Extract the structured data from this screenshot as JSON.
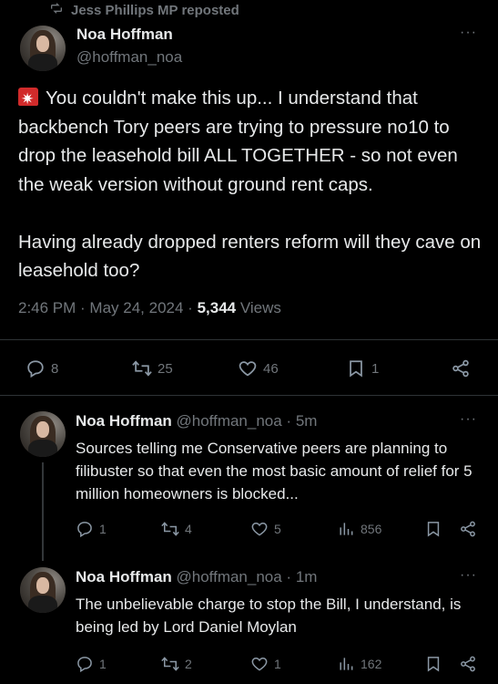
{
  "repost_banner": {
    "label": "Jess Phillips MP reposted",
    "icon": "repost-icon"
  },
  "main_post": {
    "author_name": "Noa Hoffman",
    "author_handle": "@hoffman_noa",
    "more_label": "···",
    "text_line1": "You couldn't make this up... I understand that backbench Tory peers are trying to pressure no10 to drop the leasehold bill ALL TOGETHER - so not even the weak version without ground rent caps.",
    "text_line2": "Having already dropped renters reform will they cave on leasehold too?",
    "emoji": "siren",
    "timestamp": "2:46 PM · May 24, 2024 ·",
    "views_count": "5,344",
    "views_label": "Views",
    "replies": "8",
    "reposts": "25",
    "likes": "46",
    "bookmarks": "1"
  },
  "replies": [
    {
      "author_name": "Noa Hoffman",
      "author_handle": "@hoffman_noa · 5m",
      "text": "Sources telling me Conservative peers are planning to filibuster so that even the most basic amount of relief for 5 million homeowners is blocked...",
      "replies": "1",
      "reposts": "4",
      "likes": "5",
      "views": "856",
      "more_label": "···"
    },
    {
      "author_name": "Noa Hoffman",
      "author_handle": "@hoffman_noa · 1m",
      "text": "The unbelievable charge to stop the Bill, I understand, is being led by Lord Daniel Moylan",
      "replies": "1",
      "reposts": "2",
      "likes": "1",
      "views": "162",
      "more_label": "···"
    }
  ],
  "colors": {
    "background": "#000000",
    "text": "#e7e9ea",
    "muted": "#71767b",
    "divider": "#2f3336"
  }
}
